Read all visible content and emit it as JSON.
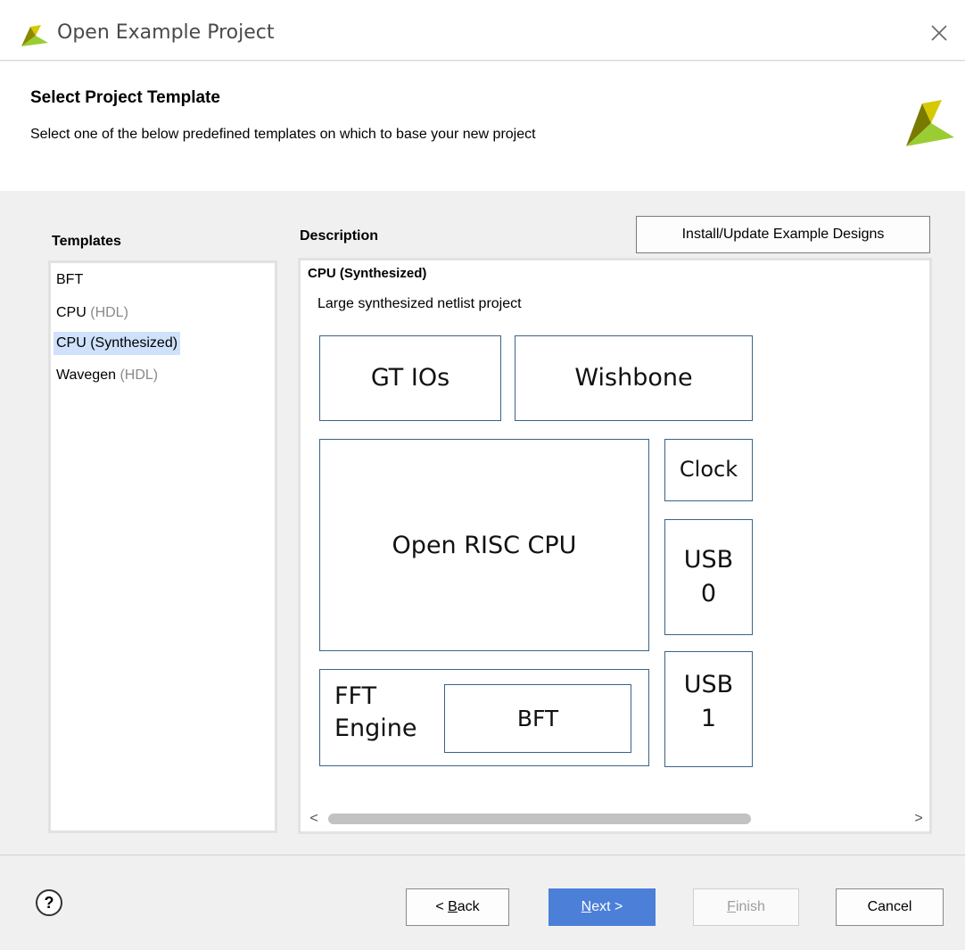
{
  "window": {
    "title": "Open Example Project"
  },
  "header": {
    "title": "Select Project Template",
    "subtitle": "Select one of the below predefined templates on which to base your new project"
  },
  "templates": {
    "label": "Templates",
    "items": [
      {
        "name": "BFT",
        "suffix": ""
      },
      {
        "name": "CPU",
        "suffix": "(HDL)"
      },
      {
        "name": "CPU (Synthesized)",
        "suffix": ""
      },
      {
        "name": "Wavegen",
        "suffix": "(HDL)"
      }
    ],
    "selected": "CPU (Synthesized)"
  },
  "description": {
    "label": "Description",
    "install_button": "Install/Update Example Designs",
    "title": "CPU (Synthesized)",
    "text": "Large synthesized netlist project",
    "blocks": {
      "gt_ios": "GT IOs",
      "wishbone": "Wishbone",
      "open_risc_cpu": "Open RISC CPU",
      "clock": "Clock",
      "usb0_line1": "USB",
      "usb0_line2": "0",
      "usb1_line1": "USB",
      "usb1_line2": "1",
      "fft_line1": "FFT",
      "fft_line2": "Engine",
      "bft": "BFT"
    },
    "scroll_left": "<",
    "scroll_right": ">"
  },
  "footer": {
    "help": "?",
    "back": {
      "prefix": "< ",
      "mnemonic": "B",
      "rest": "ack"
    },
    "next": {
      "prefix": "",
      "mnemonic": "N",
      "rest": "ext >"
    },
    "finish": {
      "prefix": "",
      "mnemonic": "F",
      "rest": "inish"
    },
    "cancel": "Cancel"
  },
  "colors": {
    "selection": "#cfe1fb",
    "primary_button": "#4b7fd8",
    "block_border": "#3a6389",
    "logo_dark": "#7a7a00",
    "logo_yellow": "#d6c900",
    "logo_green": "#9acd32"
  }
}
